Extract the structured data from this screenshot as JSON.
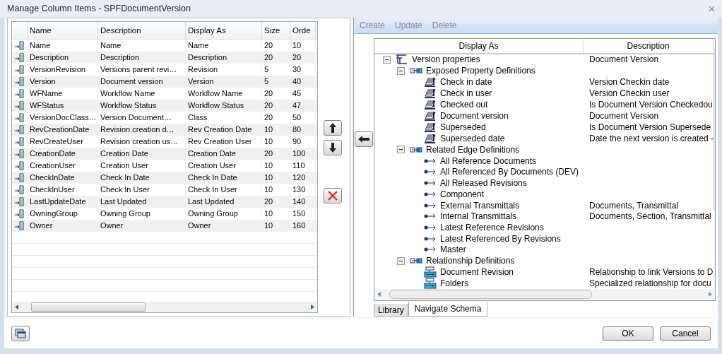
{
  "window": {
    "title": "Manage Column Items - SPFDocumentVersion"
  },
  "table": {
    "columns": [
      "Name",
      "Description",
      "Display As",
      "Size",
      "Orde"
    ],
    "rows": [
      {
        "name": "Name",
        "description": "Name",
        "display_as": "Name",
        "size": "20",
        "order": "10"
      },
      {
        "name": "Description",
        "description": "Description",
        "display_as": "Description",
        "size": "20",
        "order": "20"
      },
      {
        "name": "VersionRevision",
        "description": "Versions parent revi…",
        "display_as": "Revision",
        "size": "5",
        "order": "30"
      },
      {
        "name": "Version",
        "description": "Document version",
        "display_as": "Version",
        "size": "5",
        "order": "40"
      },
      {
        "name": "WFName",
        "description": "Workflow Name",
        "display_as": "Workflow Name",
        "size": "20",
        "order": "45"
      },
      {
        "name": "WFStatus",
        "description": "Workflow Status",
        "display_as": "Workflow Status",
        "size": "20",
        "order": "47"
      },
      {
        "name": "VersionDocClass…",
        "description": "Version  Document…",
        "display_as": "Class",
        "size": "20",
        "order": "50"
      },
      {
        "name": "RevCreationDate",
        "description": "Revision creation d…",
        "display_as": "Rev Creation Date",
        "size": "10",
        "order": "80"
      },
      {
        "name": "RevCreateUser",
        "description": "Revision creation us…",
        "display_as": "Rev Creation User",
        "size": "10",
        "order": "90"
      },
      {
        "name": "CreationDate",
        "description": "Creation Date",
        "display_as": "Creation Date",
        "size": "20",
        "order": "100"
      },
      {
        "name": "CreationUser",
        "description": "Creation User",
        "display_as": "Creation User",
        "size": "10",
        "order": "110"
      },
      {
        "name": "CheckInDate",
        "description": "Check In Date",
        "display_as": "Check In Date",
        "size": "10",
        "order": "120"
      },
      {
        "name": "CheckInUser",
        "description": "Check In User",
        "display_as": "Check In User",
        "size": "10",
        "order": "130"
      },
      {
        "name": "LastUpdateDate",
        "description": "Last Updated",
        "display_as": "Last Updated",
        "size": "20",
        "order": "140"
      },
      {
        "name": "OwningGroup",
        "description": "Owning Group",
        "display_as": "Owning Group",
        "size": "10",
        "order": "150"
      },
      {
        "name": "Owner",
        "description": "Owner",
        "display_as": "Owner",
        "size": "10",
        "order": "160"
      }
    ]
  },
  "toolbar": [
    {
      "label": "Create",
      "disabled": true
    },
    {
      "label": "Update",
      "disabled": true
    },
    {
      "label": "Delete",
      "disabled": true
    }
  ],
  "tree": {
    "columns": [
      "Display As",
      "Description"
    ],
    "nodes": [
      {
        "kind": "properties",
        "label": "Version properties",
        "description": "Document Version",
        "expanded": true,
        "children": [
          {
            "kind": "group",
            "label": "Exposed Property Definitions",
            "expanded": true,
            "children": [
              {
                "kind": "property",
                "label": "Check in date",
                "description": "Version Checkin date"
              },
              {
                "kind": "property",
                "label": "Check in user",
                "description": "Version Checkin user"
              },
              {
                "kind": "property",
                "label": "Checked out",
                "description": "Is Document Version Checkedou"
              },
              {
                "kind": "property",
                "label": "Document version",
                "description": "Document Version"
              },
              {
                "kind": "property",
                "label": "Superseded",
                "description": "Is Document Version Supersede"
              },
              {
                "kind": "property",
                "label": "Superseded date",
                "description": "Date the next version is created -"
              }
            ]
          },
          {
            "kind": "group",
            "label": "Related Edge Definitions",
            "expanded": true,
            "children": [
              {
                "kind": "edge",
                "label": "All Reference Documents"
              },
              {
                "kind": "edge",
                "label": "All Referenced By Documents (DEV)"
              },
              {
                "kind": "edge",
                "label": "All Released Revisions"
              },
              {
                "kind": "edge",
                "label": "Component"
              },
              {
                "kind": "edge",
                "label": "External Transmittals",
                "description": "Documents, Transmittal"
              },
              {
                "kind": "edge",
                "label": "Internal Transmittals",
                "description": "Documents, Section, Transmittal"
              },
              {
                "kind": "edge",
                "label": "Latest Reference Revisions"
              },
              {
                "kind": "edge",
                "label": "Latest Referenced By Revisions"
              },
              {
                "kind": "edge",
                "label": "Master"
              }
            ]
          },
          {
            "kind": "group",
            "label": "Relationship Definitions",
            "expanded": true,
            "children": [
              {
                "kind": "relationship",
                "label": "Document Revision",
                "description": "Relationship to link Versions to D"
              },
              {
                "kind": "relationship",
                "label": "Folders",
                "description": "Specialized relationship for docu"
              }
            ]
          }
        ]
      }
    ]
  },
  "tabs": [
    {
      "label": "Library",
      "selected": false
    },
    {
      "label": "Navigate Schema",
      "selected": true
    }
  ],
  "buttons": [
    "OK",
    "Cancel"
  ]
}
